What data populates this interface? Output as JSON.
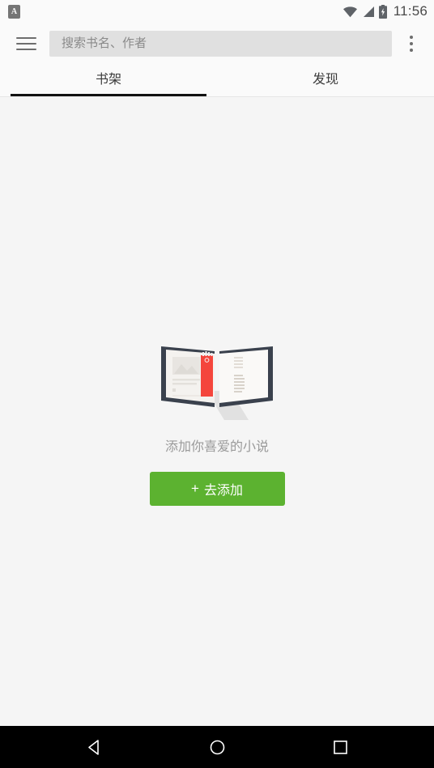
{
  "status_bar": {
    "notification_badge": "A",
    "icons": [
      "wifi-icon",
      "signal-icon",
      "battery-charging-icon"
    ],
    "time": "11:56"
  },
  "toolbar": {
    "menu_icon": "hamburger-menu-icon",
    "search": {
      "value": "",
      "placeholder": "搜索书名、作者"
    },
    "overflow_icon": "overflow-menu-icon"
  },
  "tabs": {
    "items": [
      {
        "label": "书架",
        "active": true
      },
      {
        "label": "发现",
        "active": false
      }
    ]
  },
  "empty_state": {
    "illustration": "open-book-illustration",
    "message": "添加你喜爱的小说",
    "button": {
      "plus": "+",
      "label": "去添加"
    }
  },
  "nav_bar": {
    "back": "back-triangle-icon",
    "home": "home-circle-icon",
    "recents": "recents-square-icon"
  },
  "colors": {
    "accent_green": "#5cb230",
    "toolbar_bg": "#fafafa",
    "content_bg": "#f5f5f5",
    "tab_indicator": "#111111",
    "bookmark_red": "#f4453c"
  }
}
